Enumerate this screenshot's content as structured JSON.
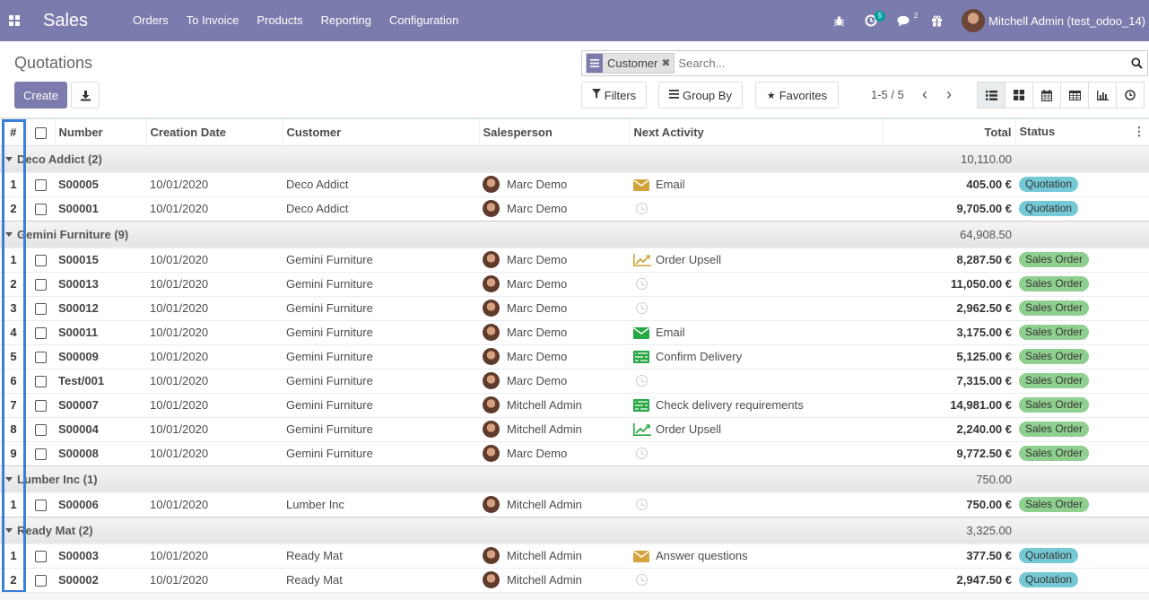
{
  "app": {
    "brand": "Sales",
    "menu": [
      "Orders",
      "To Invoice",
      "Products",
      "Reporting",
      "Configuration"
    ],
    "activity_count": "5",
    "message_count": "2",
    "user_name": "Mitchell Admin (test_odoo_14)"
  },
  "control_panel": {
    "title": "Quotations",
    "create_label": "Create",
    "facet_label": "Customer",
    "search_placeholder": "Search...",
    "filters_label": "Filters",
    "groupby_label": "Group By",
    "favorites_label": "Favorites",
    "pager": "1-5 / 5",
    "views": [
      "list-view-icon",
      "kanban-view-icon",
      "calendar-view-icon",
      "pivot-view-icon",
      "graph-view-icon",
      "activity-view-icon"
    ]
  },
  "table": {
    "headers": {
      "rownum": "#",
      "number": "Number",
      "date": "Creation Date",
      "customer": "Customer",
      "salesperson": "Salesperson",
      "activity": "Next Activity",
      "total": "Total",
      "status": "Status"
    },
    "groups": [
      {
        "label": "Deco Addict (2)",
        "total": "10,110.00",
        "rows": [
          {
            "idx": "1",
            "number": "S00005",
            "date": "10/01/2020",
            "customer": "Deco Addict",
            "salesperson": "Marc Demo",
            "activity_icon": "email",
            "activity_color": "#d4a43c",
            "activity": "Email",
            "total": "405.00 €",
            "status": "Quotation",
            "status_kind": "quotation"
          },
          {
            "idx": "2",
            "number": "S00001",
            "date": "10/01/2020",
            "customer": "Deco Addict",
            "salesperson": "Marc Demo",
            "activity_icon": "clock",
            "activity_color": "#cccccc",
            "activity": "",
            "total": "9,705.00 €",
            "status": "Quotation",
            "status_kind": "quotation"
          }
        ]
      },
      {
        "label": "Gemini Furniture (9)",
        "total": "64,908.50",
        "rows": [
          {
            "idx": "1",
            "number": "S00015",
            "date": "10/01/2020",
            "customer": "Gemini Furniture",
            "salesperson": "Marc Demo",
            "activity_icon": "upsell",
            "activity_color": "#d4a43c",
            "activity": "Order Upsell",
            "total": "8,287.50 €",
            "status": "Sales Order",
            "status_kind": "sales-order"
          },
          {
            "idx": "2",
            "number": "S00013",
            "date": "10/01/2020",
            "customer": "Gemini Furniture",
            "salesperson": "Marc Demo",
            "activity_icon": "clock",
            "activity_color": "#cccccc",
            "activity": "",
            "total": "11,050.00 €",
            "status": "Sales Order",
            "status_kind": "sales-order"
          },
          {
            "idx": "3",
            "number": "S00012",
            "date": "10/01/2020",
            "customer": "Gemini Furniture",
            "salesperson": "Marc Demo",
            "activity_icon": "clock",
            "activity_color": "#cccccc",
            "activity": "",
            "total": "2,962.50 €",
            "status": "Sales Order",
            "status_kind": "sales-order"
          },
          {
            "idx": "4",
            "number": "S00011",
            "date": "10/01/2020",
            "customer": "Gemini Furniture",
            "salesperson": "Marc Demo",
            "activity_icon": "email",
            "activity_color": "#28a745",
            "activity": "Email",
            "total": "3,175.00 €",
            "status": "Sales Order",
            "status_kind": "sales-order"
          },
          {
            "idx": "5",
            "number": "S00009",
            "date": "10/01/2020",
            "customer": "Gemini Furniture",
            "salesperson": "Marc Demo",
            "activity_icon": "tasks",
            "activity_color": "#28a745",
            "activity": "Confirm Delivery",
            "total": "5,125.00 €",
            "status": "Sales Order",
            "status_kind": "sales-order"
          },
          {
            "idx": "6",
            "number": "Test/001",
            "date": "10/01/2020",
            "customer": "Gemini Furniture",
            "salesperson": "Marc Demo",
            "activity_icon": "clock",
            "activity_color": "#cccccc",
            "activity": "",
            "total": "7,315.00 €",
            "status": "Sales Order",
            "status_kind": "sales-order"
          },
          {
            "idx": "7",
            "number": "S00007",
            "date": "10/01/2020",
            "customer": "Gemini Furniture",
            "salesperson": "Mitchell Admin",
            "activity_icon": "tasks",
            "activity_color": "#28a745",
            "activity": "Check delivery requirements",
            "total": "14,981.00 €",
            "status": "Sales Order",
            "status_kind": "sales-order"
          },
          {
            "idx": "8",
            "number": "S00004",
            "date": "10/01/2020",
            "customer": "Gemini Furniture",
            "salesperson": "Mitchell Admin",
            "activity_icon": "upsell",
            "activity_color": "#28a745",
            "activity": "Order Upsell",
            "total": "2,240.00 €",
            "status": "Sales Order",
            "status_kind": "sales-order"
          },
          {
            "idx": "9",
            "number": "S00008",
            "date": "10/01/2020",
            "customer": "Gemini Furniture",
            "salesperson": "Marc Demo",
            "activity_icon": "clock",
            "activity_color": "#cccccc",
            "activity": "",
            "total": "9,772.50 €",
            "status": "Sales Order",
            "status_kind": "sales-order"
          }
        ]
      },
      {
        "label": "Lumber Inc (1)",
        "total": "750.00",
        "rows": [
          {
            "idx": "1",
            "number": "S00006",
            "date": "10/01/2020",
            "customer": "Lumber Inc",
            "salesperson": "Mitchell Admin",
            "activity_icon": "clock",
            "activity_color": "#cccccc",
            "activity": "",
            "total": "750.00 €",
            "status": "Sales Order",
            "status_kind": "sales-order"
          }
        ]
      },
      {
        "label": "Ready Mat (2)",
        "total": "3,325.00",
        "rows": [
          {
            "idx": "1",
            "number": "S00003",
            "date": "10/01/2020",
            "customer": "Ready Mat",
            "salesperson": "Mitchell Admin",
            "activity_icon": "email",
            "activity_color": "#d4a43c",
            "activity": "Answer questions",
            "total": "377.50 €",
            "status": "Quotation",
            "status_kind": "quotation"
          },
          {
            "idx": "2",
            "number": "S00002",
            "date": "10/01/2020",
            "customer": "Ready Mat",
            "salesperson": "Mitchell Admin",
            "activity_icon": "clock",
            "activity_color": "#cccccc",
            "activity": "",
            "total": "2,947.50 €",
            "status": "Quotation",
            "status_kind": "quotation"
          }
        ]
      }
    ]
  }
}
